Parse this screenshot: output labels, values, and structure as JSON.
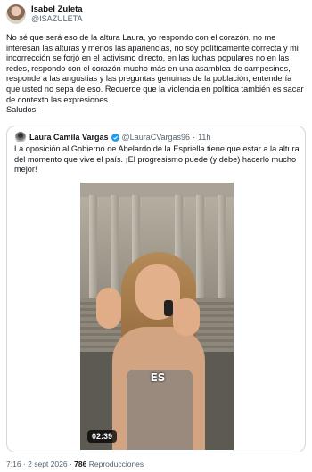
{
  "author": {
    "name": "Isabel Zuleta",
    "handle": "@ISAZULETA"
  },
  "post": {
    "text": "No sé que será eso de la altura Laura, yo respondo con el corazón, no me interesan las alturas y menos las apariencias, no soy políticamente correcta y mi incorrección se forjó en el activismo directo, en las luchas populares no en las redes, respondo con el corazón mucho más en una asamblea de campesinos, responde a las angustias y las preguntas genuinas de la población, entendería que usted no sepa de eso. Recuerde que la violencia en política también es sacar de contexto las expresiones.",
    "signoff": "Saludos."
  },
  "quote": {
    "name": "Laura Camila Vargas",
    "handle": "@LauraCVargas96",
    "separator": "·",
    "time": "11h",
    "text": "La oposición al Gobierno de Abelardo de la Espriella tiene que estar a la altura del momento que vive el país. ¡El progresismo puede (y debe) hacerlo mucho mejor!",
    "verified_color": "#1d9bf0",
    "video": {
      "caption": "ES",
      "duration": "02:39"
    }
  },
  "footer": {
    "time": "7:16",
    "separator": "·",
    "date": "2 sept 2026",
    "views_count": "786",
    "views_label": "Reproducciones"
  }
}
